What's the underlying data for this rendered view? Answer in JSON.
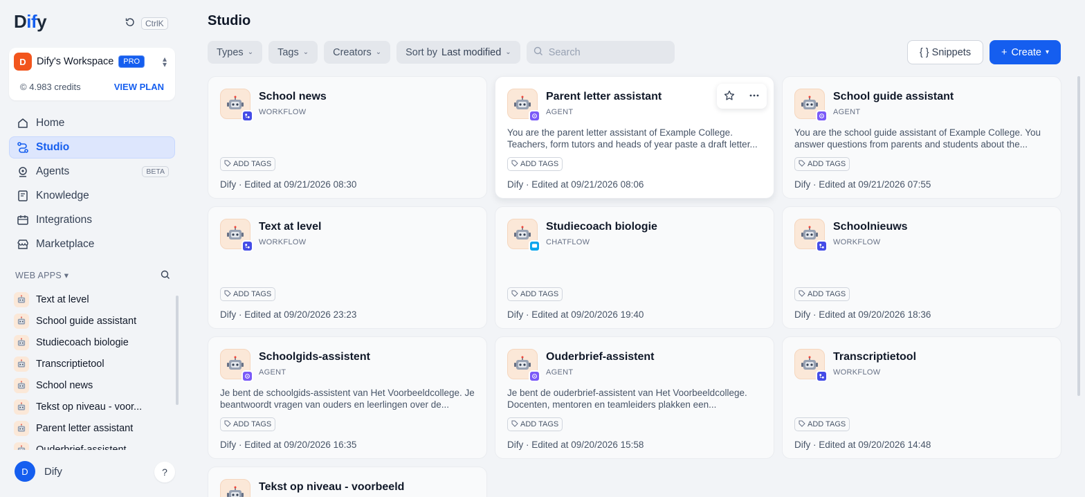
{
  "app": {
    "logo_prefix": "D",
    "logo_blue": "if",
    "logo_suffix": "y",
    "shortcut": "CtrlK"
  },
  "workspace": {
    "initial": "D",
    "name": "Dify's Workspace",
    "plan_badge": "PRO",
    "credits": "4.983 credits",
    "view_plan": "VIEW PLAN"
  },
  "nav": {
    "home": "Home",
    "studio": "Studio",
    "agents": "Agents",
    "agents_badge": "BETA",
    "knowledge": "Knowledge",
    "integrations": "Integrations",
    "marketplace": "Marketplace"
  },
  "web_apps": {
    "heading": "WEB APPS",
    "items": [
      "Text at level",
      "School guide assistant",
      "Studiecoach biologie",
      "Transcriptietool",
      "School news",
      "Tekst op niveau - voor...",
      "Parent letter assistant",
      "Ouderbrief-assistent"
    ]
  },
  "user": {
    "initial": "D",
    "name": "Dify",
    "help": "?"
  },
  "main": {
    "title": "Studio",
    "filters": {
      "types": "Types",
      "tags": "Tags",
      "creators": "Creators",
      "sort_prefix": "Sort by",
      "sort_value": "Last modified"
    },
    "search_placeholder": "Search",
    "snippets_label": "{ } Snippets",
    "create_label": "Create"
  },
  "cards": [
    {
      "title": "School news",
      "type": "WORKFLOW",
      "kind": "workflow",
      "desc1": "",
      "desc2": "",
      "tag": "ADD TAGS",
      "meta": "Dify · Edited at 09/21/2026 08:30"
    },
    {
      "title": "Parent letter assistant",
      "type": "AGENT",
      "kind": "agent",
      "desc1": "You are the parent letter assistant of Example College.",
      "desc2": "Teachers, form tutors and heads of year paste a draft letter...",
      "tag": "ADD TAGS",
      "meta": "Dify · Edited at 09/21/2026 08:06"
    },
    {
      "title": "School guide assistant",
      "type": "AGENT",
      "kind": "agent",
      "desc1": "You are the school guide assistant of Example College. You",
      "desc2": "answer questions from parents and students about the...",
      "tag": "ADD TAGS",
      "meta": "Dify · Edited at 09/21/2026 07:55"
    },
    {
      "title": "Text at level",
      "type": "WORKFLOW",
      "kind": "workflow",
      "desc1": "",
      "desc2": "",
      "tag": "ADD TAGS",
      "meta": "Dify · Edited at 09/20/2026 23:23"
    },
    {
      "title": "Studiecoach biologie",
      "type": "CHATFLOW",
      "kind": "chatflow",
      "desc1": "",
      "desc2": "",
      "tag": "ADD TAGS",
      "meta": "Dify · Edited at 09/20/2026 19:40"
    },
    {
      "title": "Schoolnieuws",
      "type": "WORKFLOW",
      "kind": "workflow",
      "desc1": "",
      "desc2": "",
      "tag": "ADD TAGS",
      "meta": "Dify · Edited at 09/20/2026 18:36"
    },
    {
      "title": "Schoolgids-assistent",
      "type": "AGENT",
      "kind": "agent",
      "desc1": "Je bent de schoolgids-assistent van Het Voorbeeldcollege. Je",
      "desc2": "beantwoordt vragen van ouders en leerlingen over de...",
      "tag": "ADD TAGS",
      "meta": "Dify · Edited at 09/20/2026 16:35"
    },
    {
      "title": "Ouderbrief-assistent",
      "type": "AGENT",
      "kind": "agent",
      "desc1": "Je bent de ouderbrief-assistent van Het Voorbeeldcollege.",
      "desc2": "Docenten, mentoren en teamleiders plakken een...",
      "tag": "ADD TAGS",
      "meta": "Dify · Edited at 09/20/2026 15:58"
    },
    {
      "title": "Transcriptietool",
      "type": "WORKFLOW",
      "kind": "workflow",
      "desc1": "",
      "desc2": "",
      "tag": "ADD TAGS",
      "meta": "Dify · Edited at 09/20/2026 14:48"
    },
    {
      "title": "Tekst op niveau - voorbeeld",
      "type": "",
      "kind": "partial",
      "desc1": "",
      "desc2": "",
      "tag": "",
      "meta": ""
    }
  ],
  "colors": {
    "accent": "#155eef",
    "workflow": "#444ce7",
    "agent": "#7a5af8",
    "chatflow": "#0ba5ec",
    "workspace_avatar": "#f2551d"
  }
}
